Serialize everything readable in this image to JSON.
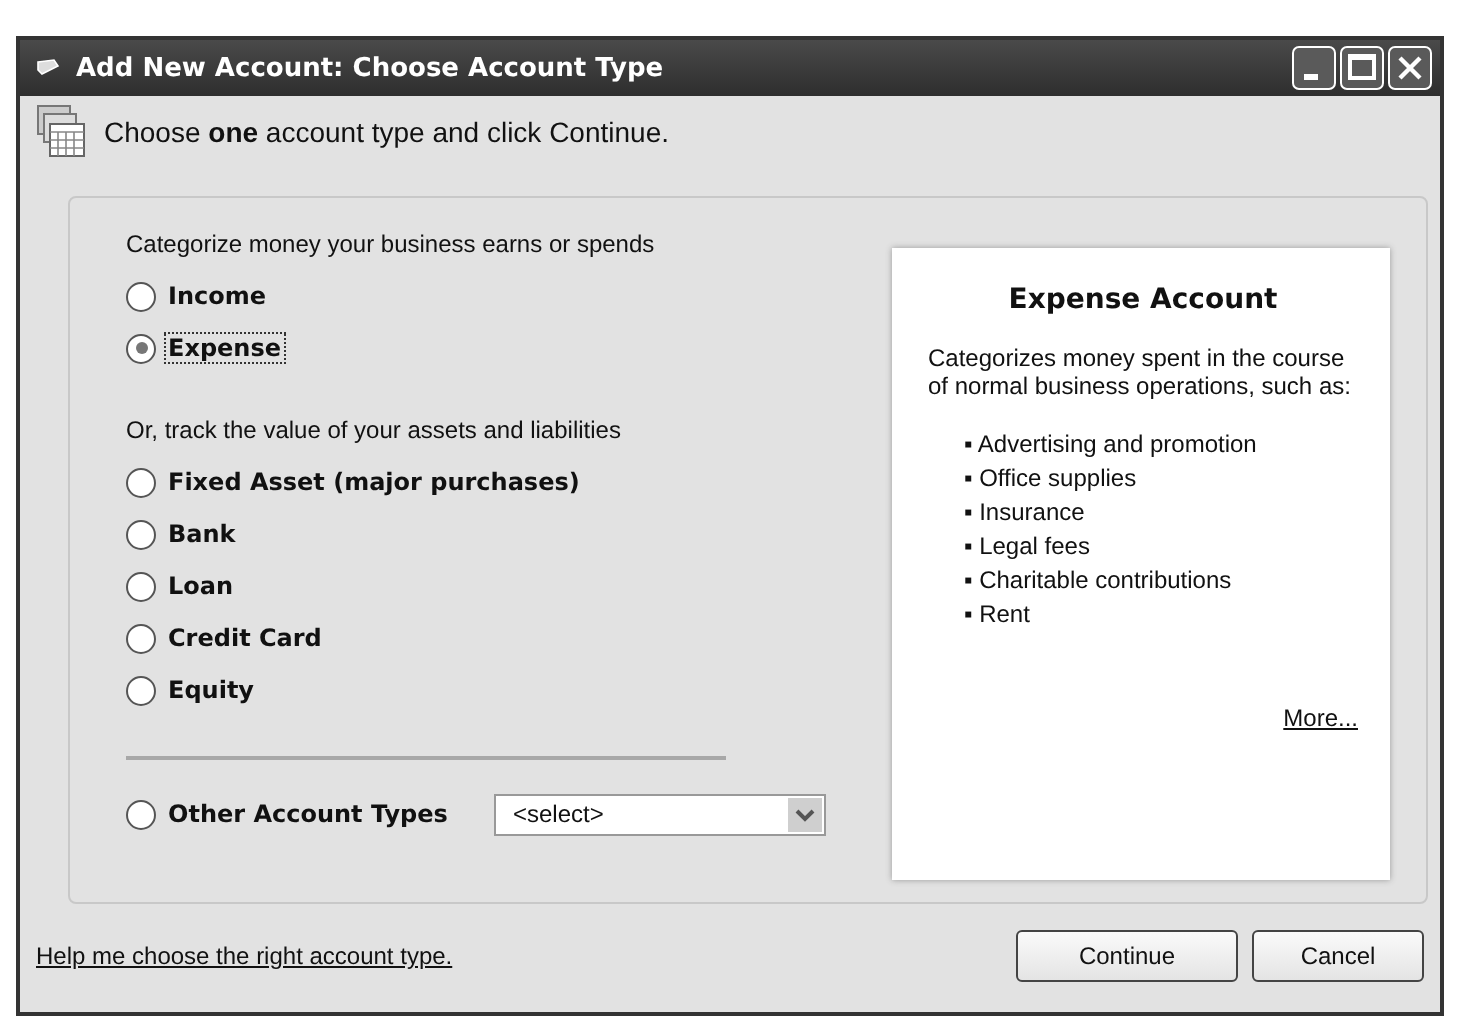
{
  "window": {
    "title": "Add New Account: Choose Account Type"
  },
  "header": {
    "text": "Choose **one** account type and click Continue."
  },
  "groups": [
    {
      "caption": "Categorize money your business earns or spends",
      "options": [
        {
          "label": "Income",
          "selected": false,
          "focused": false
        },
        {
          "label": "Expense",
          "selected": true,
          "focused": true
        }
      ]
    },
    {
      "caption": "Or, track the value of your assets and liabilities",
      "options": [
        {
          "label": "Fixed Asset (major purchases)",
          "selected": false,
          "focused": false
        },
        {
          "label": "Bank",
          "selected": false,
          "focused": false
        },
        {
          "label": "Loan",
          "selected": false,
          "focused": false
        },
        {
          "label": "Credit Card",
          "selected": false,
          "focused": false
        },
        {
          "label": "Equity",
          "selected": false,
          "focused": false
        }
      ]
    }
  ],
  "other": {
    "label": "Other Account Types",
    "selected": false,
    "dropdown": {
      "value": "<select>"
    }
  },
  "info": {
    "title": "Expense Account",
    "description": "Categorizes money spent in the course of normal business operations, such as:",
    "examples": [
      "▪ Advertising and promotion",
      "▪ Office supplies",
      "▪ Insurance",
      "▪ Legal fees",
      "▪ Charitable contributions",
      "▪ Rent"
    ],
    "more_link": "More..."
  },
  "help_link": "Help me choose the right account type.",
  "buttons": [
    {
      "label": "Continue"
    },
    {
      "label": "Cancel"
    }
  ]
}
